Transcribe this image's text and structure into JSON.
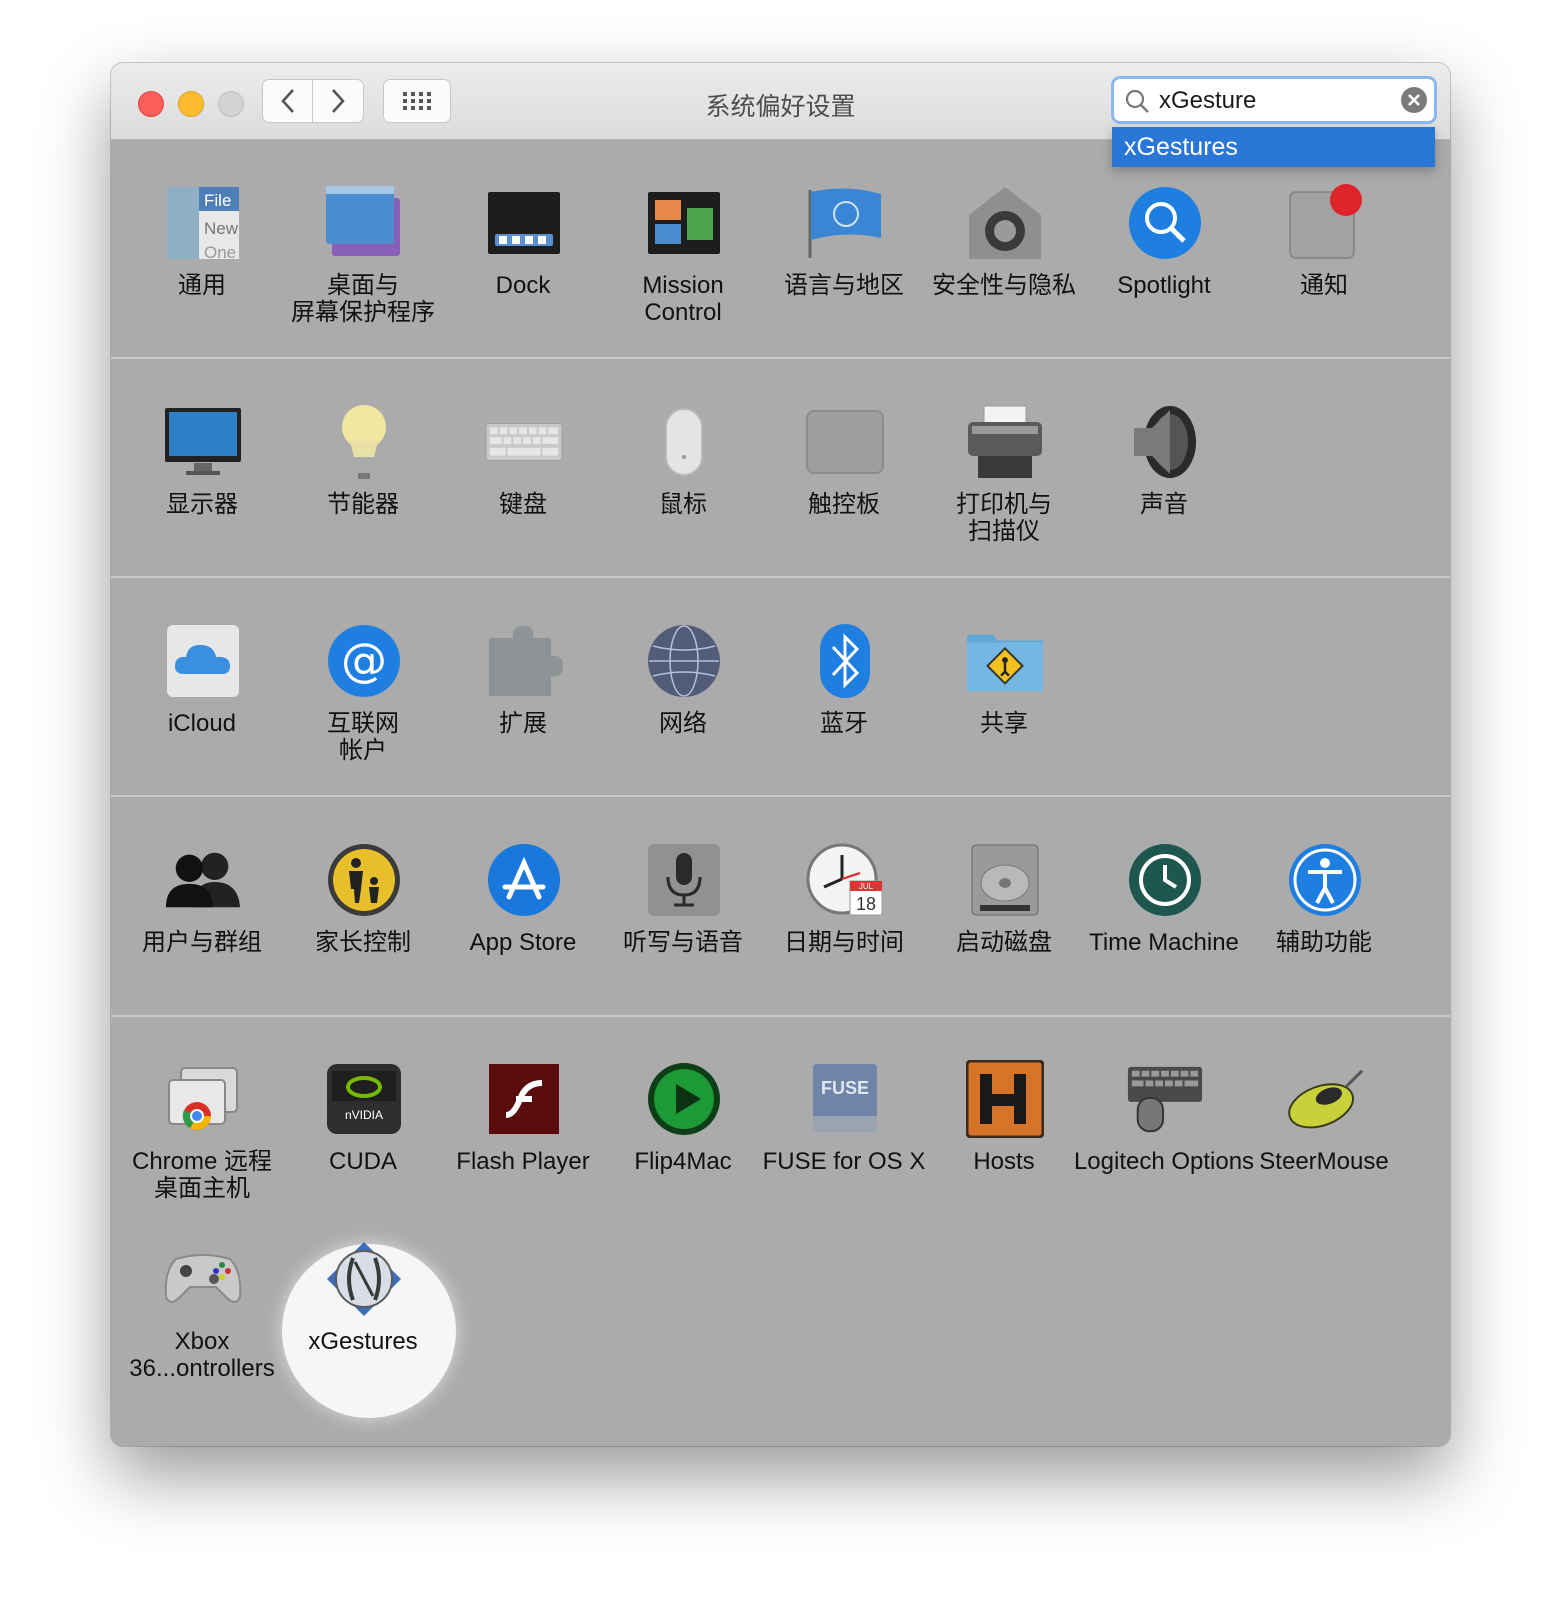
{
  "window": {
    "title": "系统偏好设置"
  },
  "search": {
    "query": "xGesture",
    "suggestion": "xGestures"
  },
  "rows": [
    {
      "items": [
        {
          "label": "通用",
          "icon": "general-icon"
        },
        {
          "label": "桌面与\n屏幕保护程序",
          "icon": "desktop-screensaver-icon"
        },
        {
          "label": "Dock",
          "icon": "dock-icon"
        },
        {
          "label": "Mission\nControl",
          "icon": "mission-control-icon"
        },
        {
          "label": "语言与地区",
          "icon": "language-region-icon"
        },
        {
          "label": "安全性与隐私",
          "icon": "security-privacy-icon"
        },
        {
          "label": "Spotlight",
          "icon": "spotlight-icon"
        },
        {
          "label": "通知",
          "icon": "notifications-icon"
        }
      ]
    },
    {
      "items": [
        {
          "label": "显示器",
          "icon": "displays-icon"
        },
        {
          "label": "节能器",
          "icon": "energy-saver-icon"
        },
        {
          "label": "键盘",
          "icon": "keyboard-icon"
        },
        {
          "label": "鼠标",
          "icon": "mouse-icon"
        },
        {
          "label": "触控板",
          "icon": "trackpad-icon"
        },
        {
          "label": "打印机与\n扫描仪",
          "icon": "printers-scanners-icon"
        },
        {
          "label": "声音",
          "icon": "sound-icon"
        }
      ]
    },
    {
      "items": [
        {
          "label": "iCloud",
          "icon": "icloud-icon"
        },
        {
          "label": "互联网\n帐户",
          "icon": "internet-accounts-icon"
        },
        {
          "label": "扩展",
          "icon": "extensions-icon"
        },
        {
          "label": "网络",
          "icon": "network-icon"
        },
        {
          "label": "蓝牙",
          "icon": "bluetooth-icon"
        },
        {
          "label": "共享",
          "icon": "sharing-icon"
        }
      ]
    },
    {
      "items": [
        {
          "label": "用户与群组",
          "icon": "users-groups-icon"
        },
        {
          "label": "家长控制",
          "icon": "parental-controls-icon"
        },
        {
          "label": "App Store",
          "icon": "app-store-icon"
        },
        {
          "label": "听写与语音",
          "icon": "dictation-speech-icon"
        },
        {
          "label": "日期与时间",
          "icon": "date-time-icon"
        },
        {
          "label": "启动磁盘",
          "icon": "startup-disk-icon"
        },
        {
          "label": "Time Machine",
          "icon": "time-machine-icon"
        },
        {
          "label": "辅助功能",
          "icon": "accessibility-icon"
        }
      ]
    },
    {
      "items": [
        {
          "label": "Chrome 远程\n桌面主机",
          "icon": "chrome-remote-desktop-icon"
        },
        {
          "label": "CUDA",
          "icon": "cuda-icon"
        },
        {
          "label": "Flash Player",
          "icon": "flash-player-icon"
        },
        {
          "label": "Flip4Mac",
          "icon": "flip4mac-icon"
        },
        {
          "label": "FUSE for OS X",
          "icon": "fuse-icon"
        },
        {
          "label": "Hosts",
          "icon": "hosts-icon"
        },
        {
          "label": "Logitech Options",
          "icon": "logitech-options-icon"
        },
        {
          "label": "SteerMouse",
          "icon": "steermouse-icon"
        },
        {
          "label": "Xbox 36...ontrollers",
          "icon": "xbox-controllers-icon"
        },
        {
          "label": "xGestures",
          "icon": "xgestures-icon"
        }
      ]
    }
  ],
  "icon_text": {
    "general": [
      "File",
      "New",
      "One"
    ],
    "calendar_month": "JUL",
    "calendar_day": "18",
    "cuda_brand": "nVIDIA",
    "fuse_brand": "FUSE"
  },
  "colors": {
    "background": "#ababab",
    "selection": "#2a76d6",
    "close": "#fc5f57",
    "minimize": "#fdbc2e"
  }
}
